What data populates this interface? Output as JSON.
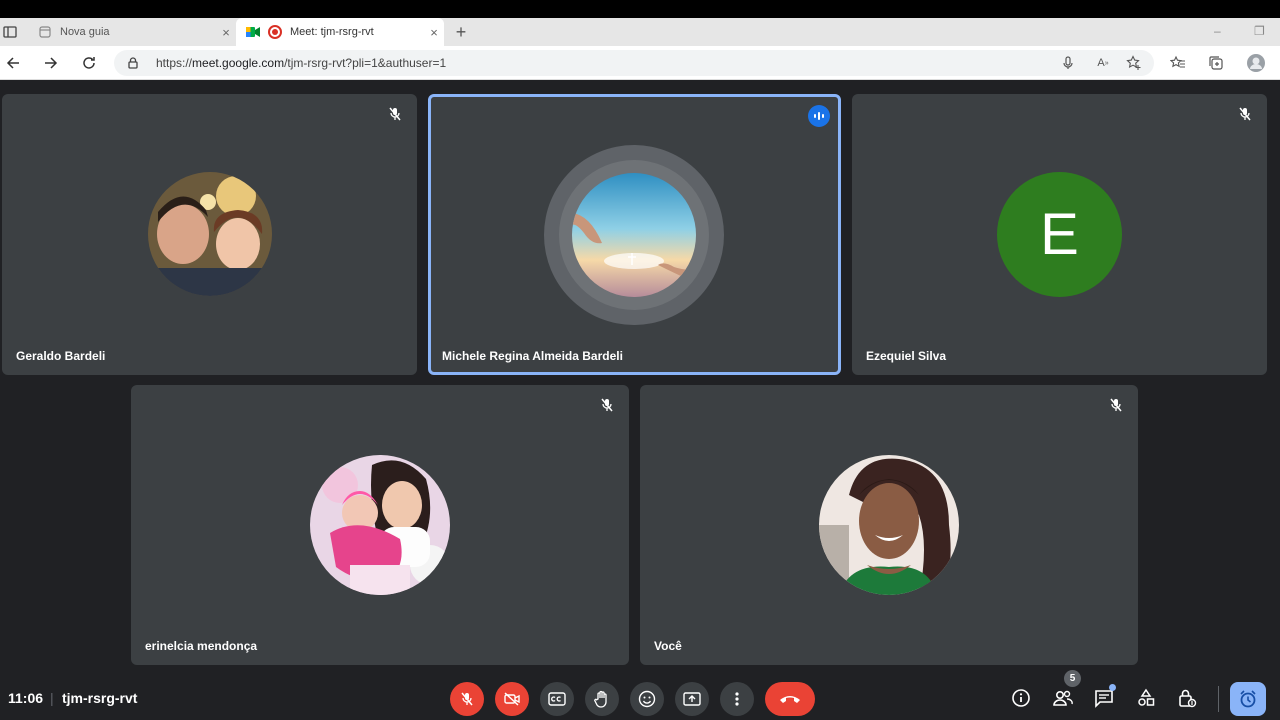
{
  "browser": {
    "tabs": [
      {
        "title": "Nova guia",
        "close": "×"
      },
      {
        "title": "Meet: tjm-rsrg-rvt",
        "close": "×"
      }
    ],
    "new_tab": "+",
    "window_controls": {
      "minimize": "–",
      "restore": "❐"
    },
    "url_prefix": "https://",
    "url_host": "meet.google.com",
    "url_path": "/tjm-rsrg-rvt?pli=1&authuser=1"
  },
  "participants": [
    {
      "name": "Geraldo Bardeli",
      "muted": true,
      "avatar": "photo-man-with-child"
    },
    {
      "name": "Michele Regina Almeida Bardeli",
      "speaking": true,
      "avatar": "photo-sky-hands"
    },
    {
      "name": "Ezequiel Silva",
      "muted": true,
      "avatar_letter": "E",
      "avatar_color": "#2e7d1f"
    },
    {
      "name": "erinelcia mendonça",
      "muted": true,
      "avatar": "photo-two-girls"
    },
    {
      "name": "Você",
      "muted": true,
      "avatar": "photo-woman-smiling"
    }
  ],
  "meeting": {
    "time": "11:06",
    "separator": "|",
    "code": "tjm-rsrg-rvt",
    "people_count": "5"
  },
  "colors": {
    "background": "#202124",
    "tile": "#3c4043",
    "active_border": "#8ab4f8",
    "danger": "#ea4335",
    "accent": "#1a73e8"
  },
  "controls": [
    "mic-off-icon",
    "camera-off-icon",
    "captions-icon",
    "raise-hand-icon",
    "emoji-icon",
    "present-icon",
    "more-icon",
    "hangup-icon"
  ],
  "side_controls": [
    "info-icon",
    "people-icon",
    "chat-icon",
    "activities-icon",
    "host-controls-icon"
  ]
}
